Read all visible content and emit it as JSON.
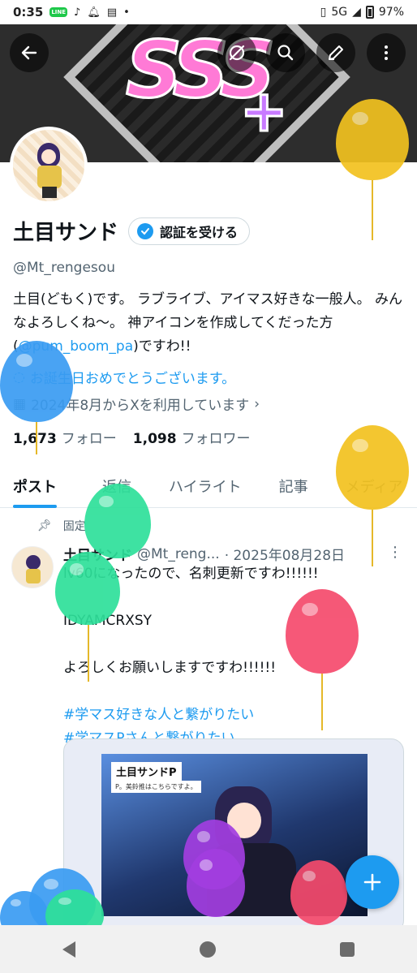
{
  "status_bar": {
    "time": "0:35",
    "network": "5G",
    "battery": "97%"
  },
  "banner": {
    "logo_text": "SSS",
    "logo_plus": "+"
  },
  "profile": {
    "name": "土目サンド",
    "verify_label": "認証を受ける",
    "handle": "@Mt_rengesou",
    "bio_before": "土目(どもく)です。 ラブライブ、アイマス好きな一般人。 みんなよろしくね〜。 神アイコンを作成してくだった方(",
    "bio_mention": "@pum_boom_pa",
    "bio_after": ")ですわ!!",
    "birthday": "お誕生日おめでとうございます。",
    "joined": "2024年8月からXを利用しています",
    "following_count": "1,673",
    "following_label": "フォロー",
    "followers_count": "1,098",
    "followers_label": "フォロワー"
  },
  "tabs": [
    "ポスト",
    "返信",
    "ハイライト",
    "記事",
    "メディア"
  ],
  "post": {
    "pinned_label": "固定",
    "author": "土目サンド",
    "handle": "@Mt_reng...",
    "date": "· 2025年08月28日",
    "line1": "lv60になったので、名刺更新ですわ!!!!!!",
    "line2": "IDYAMCRXSY",
    "line3": "よろしくお願いしますですわ!!!!!!",
    "tag1": "#学マス好きな人と繋がりたい",
    "tag2": "#学マスPさんと繋がりたい",
    "media_title": "土目サンドP",
    "media_sub": "P。美鈴推はこちらですよ。"
  },
  "colors": {
    "accent": "#1d9bf0",
    "text": "#0f1419",
    "muted": "#536471"
  }
}
